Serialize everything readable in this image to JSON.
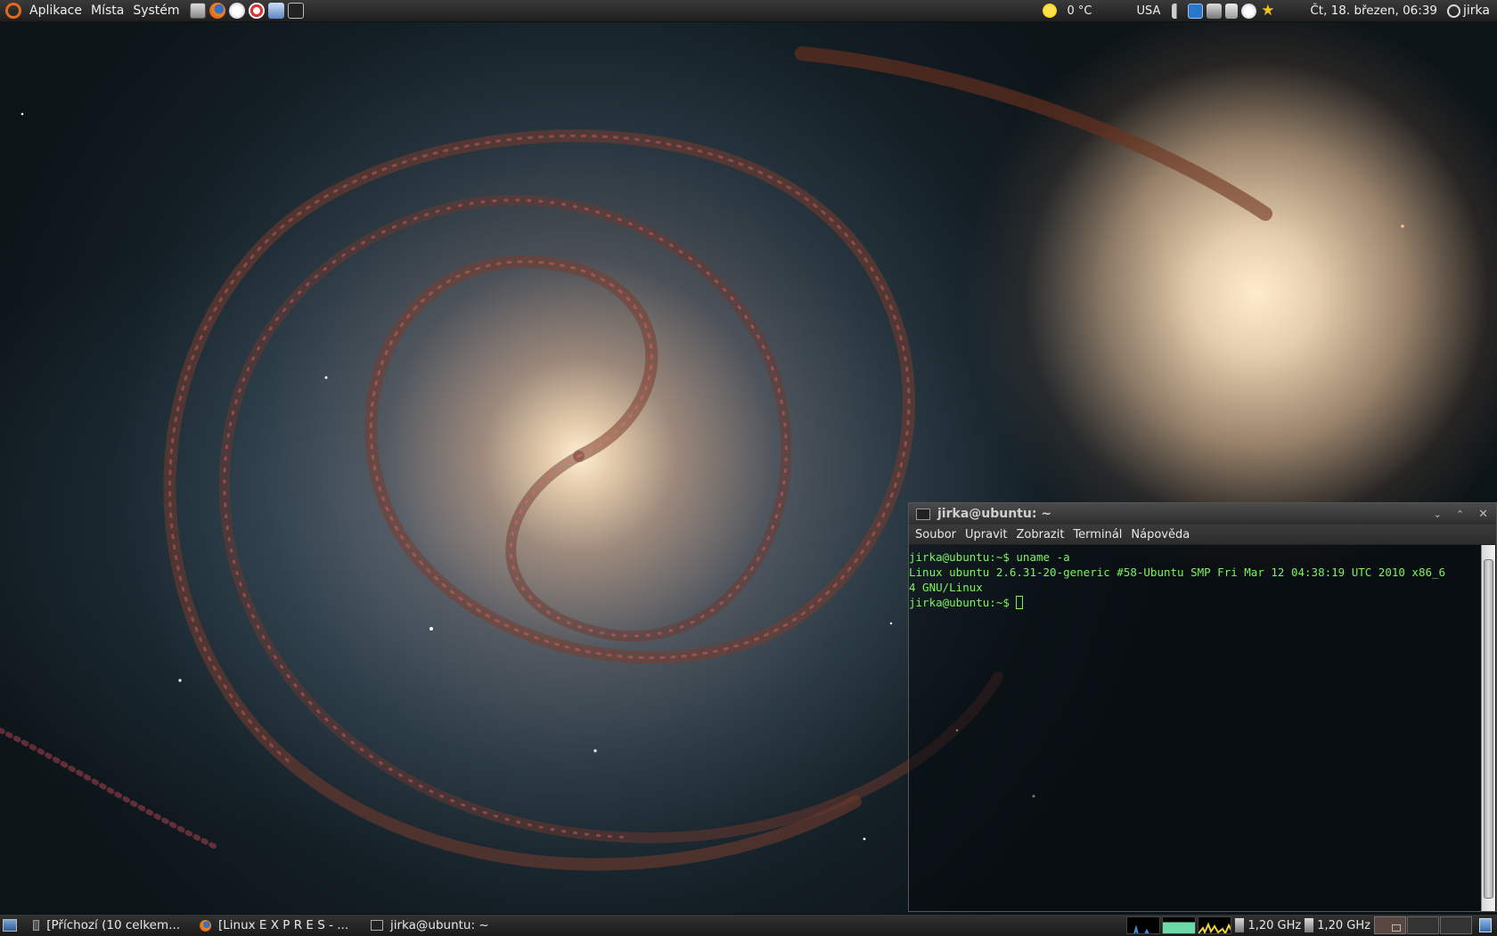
{
  "top_panel": {
    "menus": [
      "Aplikace",
      "Místa",
      "Systém"
    ],
    "launchers": [
      "calculator-icon",
      "firefox-icon",
      "mail-icon",
      "help-icon",
      "network-icon",
      "terminal-icon"
    ],
    "weather": "0 °C",
    "keyboard_layout": "USA",
    "tray_icons": [
      "volume-icon",
      "bluetooth-icon",
      "display-icon",
      "power-icon",
      "update-icon",
      "star-icon"
    ],
    "clock": "Čt, 18. březen, 06:39",
    "user": "jirka"
  },
  "terminal": {
    "title": "jirka@ubuntu: ~",
    "menu": [
      "Soubor",
      "Upravit",
      "Zobrazit",
      "Terminál",
      "Nápověda"
    ],
    "lines": [
      "jirka@ubuntu:~$ uname -a",
      "Linux ubuntu 2.6.31-20-generic #58-Ubuntu SMP Fri Mar 12 04:38:19 UTC 2010 x86_6",
      "4 GNU/Linux",
      "jirka@ubuntu:~$ "
    ]
  },
  "taskbar": {
    "tasks": [
      "[Příchozí (10 celkem...",
      "[Linux E X P R E S - ...",
      "jirka@ubuntu: ~"
    ],
    "cpu_freq_1": "1,20 GHz",
    "cpu_freq_2": "1,20 GHz"
  },
  "colors": {
    "terminal_text": "#7cf45a",
    "panel": "#2a2a2a",
    "net_monitor": "#6fd8a8"
  }
}
